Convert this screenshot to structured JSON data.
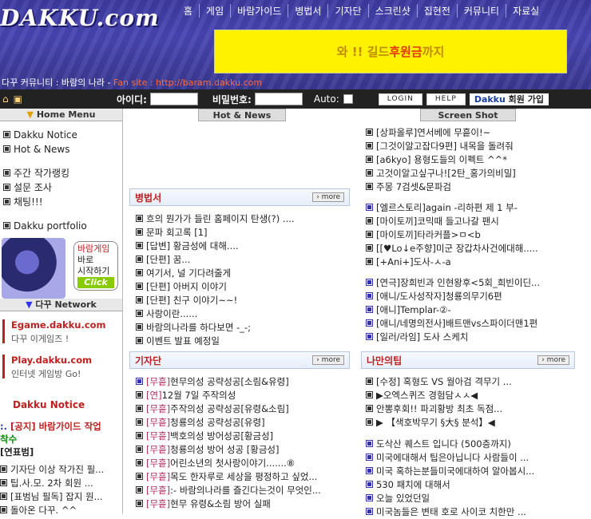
{
  "header": {
    "logo": "DAKKU.com",
    "nav": [
      "홈",
      "게임",
      "바람가이드",
      "병법서",
      "기자단",
      "스크린샷",
      "집현전",
      "커뮤니티",
      "자료실"
    ],
    "ad_prefix": "와 !! 길드",
    "ad_highlight": "후원금",
    "ad_suffix": "까지",
    "site_line": "다꾸 커뮤니티 : 바람의 나라 - ",
    "site_url": "Fan site : http://baram.dakku.com"
  },
  "login": {
    "id_label": "아이디:",
    "pw_label": "비밀번호:",
    "auto_label": "Auto:",
    "login_btn": "LOGIN",
    "help_btn": "HELP",
    "join_brand": "Dakku",
    "join_text": "회원 가입"
  },
  "left": {
    "home_menu": "Home Menu",
    "menu1": [
      "Dakku Notice",
      "Hot & News"
    ],
    "menu2": [
      "주간 작가랭킹",
      "설문 조사",
      "채팅!!!"
    ],
    "menu3": [
      "Dakku portfolio"
    ],
    "promo_line1": "바람게임",
    "promo_line2": "바로",
    "promo_line3": "시작하기",
    "promo_click": "Click",
    "network_title": "다꾸 Network",
    "net1_title": "Egame.dakku.com",
    "net1_sub": "다꾸 이게임즈 !",
    "net2_title": "Play.dakku.com",
    "net2_sub": "인터넷 게임방 Go!",
    "notice_title": "Dakku Notice",
    "notice_main": "[공지] 바람가이드 작업",
    "notice_main2": "착수",
    "notice_cat": "[연표범]",
    "notice_items": [
      "기자단 이상 작가진 필...",
      "팁.사.모. 2차 회원 ...",
      "[표범님 필독] 잡지 원...",
      "돌아온 다꾸. ^^"
    ]
  },
  "main": {
    "hot_news": "Hot & News",
    "screen_shot": "Screen Shot",
    "more": "more",
    "right_top": [
      "[상파올루]연서베에 무흩이!~",
      "[그것이알고잡다9편] 내목을 돌려줘",
      "[a6kyo] 용형도들의 이펙트 ^^*",
      "고것이알고싶구나![2탄_홍가의비밀]",
      "주몽 7검셋&문파검"
    ],
    "right_mid": [
      "[엘르스토리]again -리하편 제 1 부-",
      "[마이토끼]코믹때 들고나갈 팬시",
      "[마이토끼]타라커플>ㅁ<b",
      "[[♥Lo↓e주향]미군 장갑차사건에대해.....",
      "[+Ani+]도사-ㅅ-a"
    ],
    "right_blue": [
      "[연극]장희빈과 인현왕후<5회_희빈이딘...",
      "[애니/도사성작자]청룡의무기6편",
      "[애니]Templar-②-",
      "[애니/네명의전사]배트맨vs스파이더맨1편",
      "[일러/라임] 도사 스케치"
    ],
    "bb_title": "병법서",
    "bb_items": [
      "흐의 뭔가가 들린 홈페이지 탄생(?) ....",
      "문파 회고록 [1]",
      "[답변] 황금성에 대해....",
      "[단편] 꿈...",
      "여기서, 널 기다려줄게",
      "[단편] 아버지 이야기",
      "[단편] 친구 이야기~~!",
      "사랑이란......",
      "바람의나라를 하다보면 -_-;",
      "이벤트 발표 예정일"
    ],
    "gj_title": "기자단",
    "gj_items": [
      {
        "tag": "[무흩]",
        "text": "현무의성 공략성공[소림&유령]"
      },
      {
        "tag": "[연]",
        "text": "12월 7일 주작의성"
      },
      {
        "tag": "[무흩]",
        "text": "주작의성 공략성공[유령&소림]"
      },
      {
        "tag": "[무흩]",
        "text": "청룡의성 공략성공[유령]"
      },
      {
        "tag": "[무흩]",
        "text": "백호의성 방어성공[황금성]"
      },
      {
        "tag": "[무흩]",
        "text": "청룡의성 방어 성공 [황금성]"
      },
      {
        "tag": "[무흩]",
        "text": "어린소년의 첫사랑이야기.......⑧"
      },
      {
        "tag": "[무흩]",
        "text": "목도 한자루로 세상을 평정하고 싶었..."
      },
      {
        "tag": "[무흩]",
        "text": ":- 바람의나라를 즐긴다는것이 무엇인..."
      },
      {
        "tag": "[무흩]",
        "text": "현무 유령&소림 방어 실패"
      }
    ],
    "tip_title": "나만의팁",
    "tip_items": [
      "[수정] 혹형도 VS 월아검 격무기 ...",
      "▶오엑스퀴즈 경험담ㅅㅅ◀",
      "안뽕후회!! 파괴황방 최초 독점...",
      "▶ 【색호박무기 §大§ 분석】◀"
    ],
    "tip_items2": [
      "도삭산 퀘스트 입니다 (500층까지)",
      "미국에대해서 팁은아닙니다 사람들이 ...",
      "미국 혹하는분들미국에대하여 알아봅시...",
      "530 패치에 대해서",
      "오늘 있었던일",
      "미국놈들은 변태 호로 사이코 치한만 ..."
    ]
  }
}
